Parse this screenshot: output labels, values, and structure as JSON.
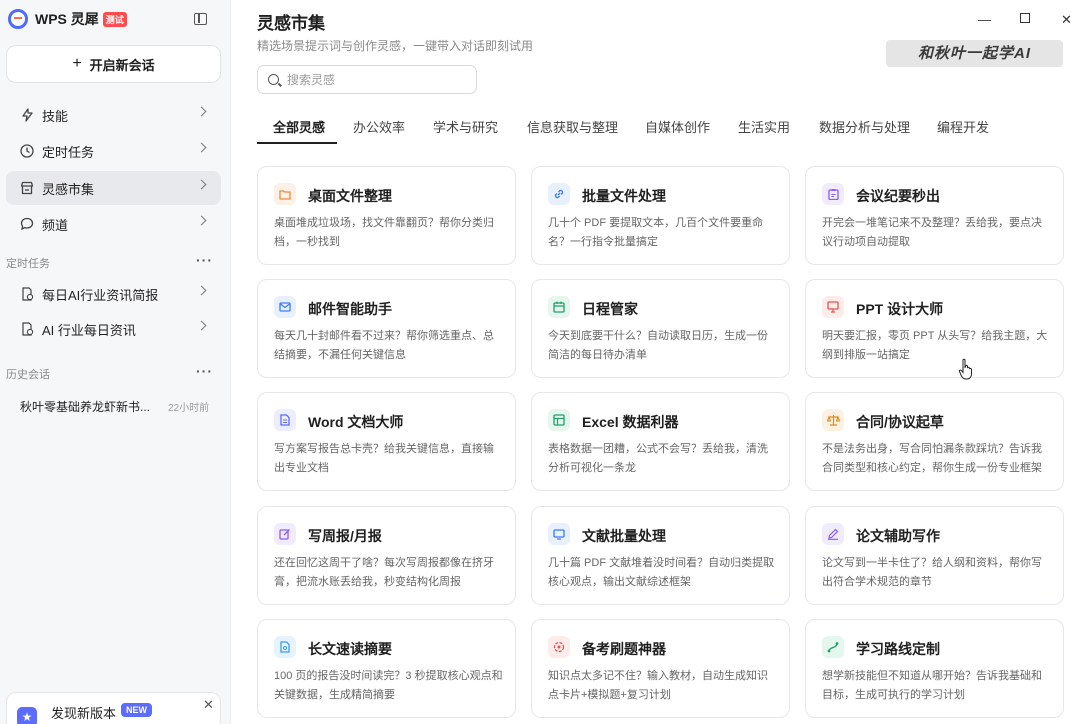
{
  "app": {
    "name": "WPS 灵犀",
    "badge": "测试"
  },
  "sidebar": {
    "new_chat": "开启新会话",
    "nav": [
      {
        "label": "技能",
        "icon": "bolt-icon"
      },
      {
        "label": "定时任务",
        "icon": "clock-icon"
      },
      {
        "label": "灵感市集",
        "icon": "store-icon",
        "active": true
      },
      {
        "label": "频道",
        "icon": "chat-icon"
      }
    ],
    "scheduled_label": "定时任务",
    "scheduled": [
      {
        "label": "每日AI行业资讯简报"
      },
      {
        "label": "AI 行业每日资讯"
      }
    ],
    "history_label": "历史会话",
    "history": [
      {
        "title": "秋叶零基础养龙虾新书...",
        "time": "22小时前"
      }
    ],
    "update": {
      "text": "发现新版本",
      "badge": "NEW"
    }
  },
  "main": {
    "title": "灵感市集",
    "subtitle": "精选场景提示词与创作灵感，一键带入对话即刻试用",
    "watermark": "和秋叶一起学AI",
    "search_placeholder": "搜索灵感",
    "tabs": [
      "全部灵感",
      "办公效率",
      "学术与研究",
      "信息获取与整理",
      "自媒体创作",
      "生活实用",
      "数据分析与处理",
      "编程开发"
    ],
    "cards": [
      {
        "title": "桌面文件整理",
        "desc": "桌面堆成垃圾场，找文件靠翻页？帮你分类归档，一秒找到",
        "icon": "folder-icon",
        "color": "#f28a3c",
        "bg": "#fdf0e6"
      },
      {
        "title": "批量文件处理",
        "desc": "几十个 PDF 要提取文本，几百个文件要重命名？一行指令批量搞定",
        "icon": "link-icon",
        "color": "#3b7cf5",
        "bg": "#e8f0fe"
      },
      {
        "title": "会议纪要秒出",
        "desc": "开完会一堆笔记来不及整理？丢给我，要点决议行动项自动提取",
        "icon": "clipboard-icon",
        "color": "#8b5cf6",
        "bg": "#f1ebfe"
      },
      {
        "title": "邮件智能助手",
        "desc": "每天几十封邮件看不过来？帮你筛选重点、总结摘要，不漏任何关键信息",
        "icon": "mail-icon",
        "color": "#3b7cf5",
        "bg": "#e8f0fe"
      },
      {
        "title": "日程管家",
        "desc": "今天到底要干什么？自动读取日历，生成一份简洁的每日待办清单",
        "icon": "calendar-icon",
        "color": "#22a06b",
        "bg": "#e5f6ee"
      },
      {
        "title": "PPT 设计大师",
        "desc": "明天要汇报，零页 PPT 从头写？给我主题，大纲到排版一站搞定",
        "icon": "presentation-icon",
        "color": "#e5534b",
        "bg": "#fdecea"
      },
      {
        "title": "Word 文档大师",
        "desc": "写方案写报告总卡壳？给我关键信息，直接输出专业文档",
        "icon": "document-icon",
        "color": "#5b6cff",
        "bg": "#eceefe"
      },
      {
        "title": "Excel 数据利器",
        "desc": "表格数据一团糟，公式不会写？丢给我，清洗分析可视化一条龙",
        "icon": "table-icon",
        "color": "#22a06b",
        "bg": "#e5f6ee"
      },
      {
        "title": "合同/协议起草",
        "desc": "不是法务出身，写合同怕漏条款踩坑？告诉我合同类型和核心约定，帮你生成一份专业框架",
        "icon": "scale-icon",
        "color": "#e08a1e",
        "bg": "#fdf2e1"
      },
      {
        "title": "写周报/月报",
        "desc": "还在回忆这周干了啥？每次写周报都像在挤牙膏，把流水账丢给我，秒变结构化周报",
        "icon": "edit-icon",
        "color": "#8b5cf6",
        "bg": "#f1ebfe"
      },
      {
        "title": "文献批量处理",
        "desc": "几十篇 PDF 文献堆着没时间看？自动归类提取核心观点，输出文献综述框架",
        "icon": "monitor-icon",
        "color": "#3b7cf5",
        "bg": "#e8f0fe"
      },
      {
        "title": "论文辅助写作",
        "desc": "论文写到一半卡住了？给人纲和资料，帮你写出符合学术规范的章节",
        "icon": "pen-icon",
        "color": "#8b5cf6",
        "bg": "#f1ebfe"
      },
      {
        "title": "长文速读摘要",
        "desc": "100 页的报告没时间读完？3 秒提取核心观点和关键数据，生成精简摘要",
        "icon": "file-icon",
        "color": "#3b9cf5",
        "bg": "#e6f3fd"
      },
      {
        "title": "备考刷题神器",
        "desc": "知识点太多记不住？输入教材，自动生成知识点卡片+模拟题+复习计划",
        "icon": "brain-icon",
        "color": "#e5534b",
        "bg": "#fdecea"
      },
      {
        "title": "学习路线定制",
        "desc": "想学新技能但不知道从哪开始？告诉我基础和目标，生成可执行的学习计划",
        "icon": "route-icon",
        "color": "#22a06b",
        "bg": "#e5f6ee"
      }
    ]
  }
}
